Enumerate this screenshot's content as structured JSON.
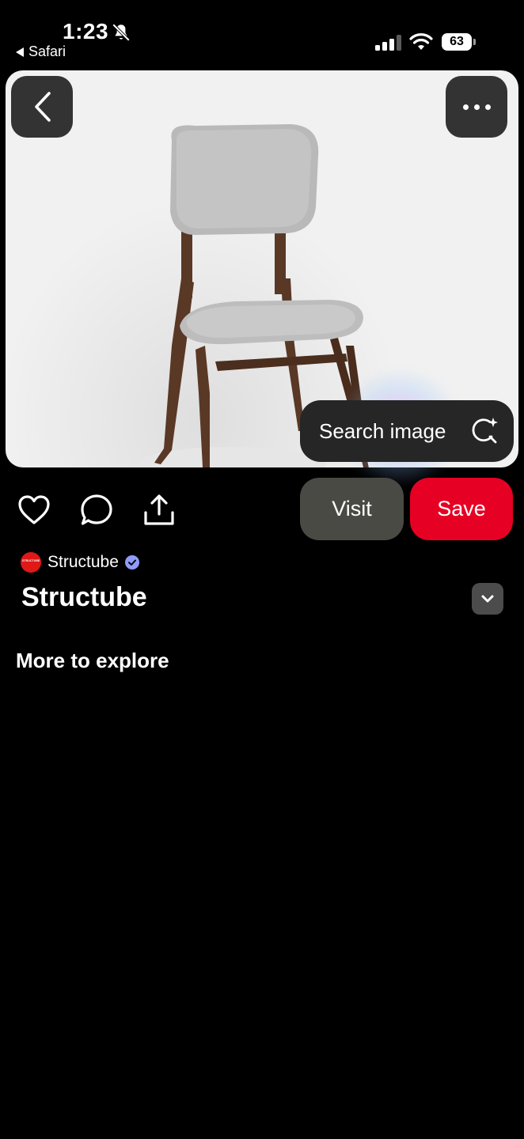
{
  "status_bar": {
    "time": "1:23",
    "back_app": "Safari",
    "battery": "63"
  },
  "pin": {
    "search_image_label": "Search image",
    "visit_label": "Visit",
    "save_label": "Save",
    "source": {
      "name": "Structube",
      "logo_text": "STRUCTUBE",
      "verified": true
    },
    "title": "Structube"
  },
  "sections": {
    "more_to_explore": "More to explore"
  },
  "colors": {
    "save": "#e60023",
    "visit": "#4a4a44",
    "verified": "#8e9cff"
  },
  "icons": [
    "bell-off-icon",
    "signal-icon",
    "wifi-icon",
    "battery-icon",
    "back-chevron-icon",
    "more-icon",
    "visual-search-icon",
    "heart-icon",
    "comment-icon",
    "share-icon",
    "verified-icon",
    "chevron-down-icon"
  ]
}
